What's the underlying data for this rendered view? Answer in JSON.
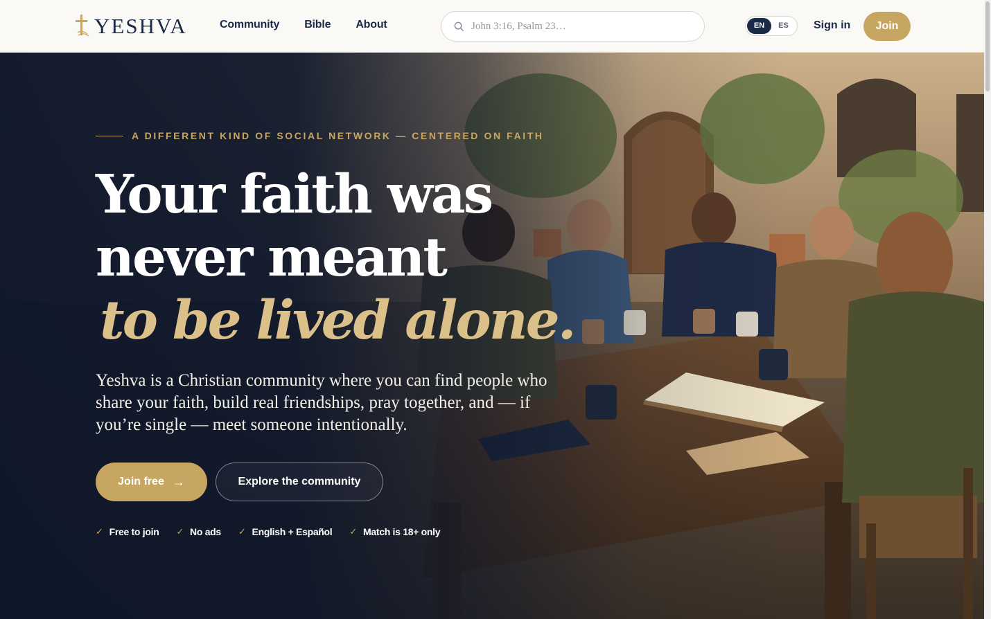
{
  "header": {
    "logo_text": "YESHVA",
    "nav": [
      {
        "label": "Community"
      },
      {
        "label": "Bible"
      },
      {
        "label": "About"
      }
    ],
    "search_placeholder": "John 3:16, Psalm 23…",
    "lang_active": "EN",
    "lang_inactive": "ES",
    "signin_label": "Sign in",
    "join_label": "Join"
  },
  "hero": {
    "eyebrow": "A DIFFERENT KIND OF SOCIAL NETWORK — CENTERED ON FAITH",
    "headline_line1": "Your faith was",
    "headline_line2": "never meant",
    "headline_line3": "to be lived alone.",
    "subtext": "Yeshva is a Christian community where you can find people who share your faith, build real friendships, pray together, and — if you’re single — meet someone intentionally.",
    "primary_cta": "Join free",
    "primary_cta_icon": "arrow-right-icon",
    "secondary_cta": "Explore the community",
    "perks": [
      "Free to join",
      "No ads",
      "English + Español",
      "Match is 18+ only"
    ]
  },
  "colors": {
    "navy": "#1b2a47",
    "gold": "#c7a662",
    "hero_bg": "#0f1a2e",
    "header_bg": "#fbf9f5"
  }
}
